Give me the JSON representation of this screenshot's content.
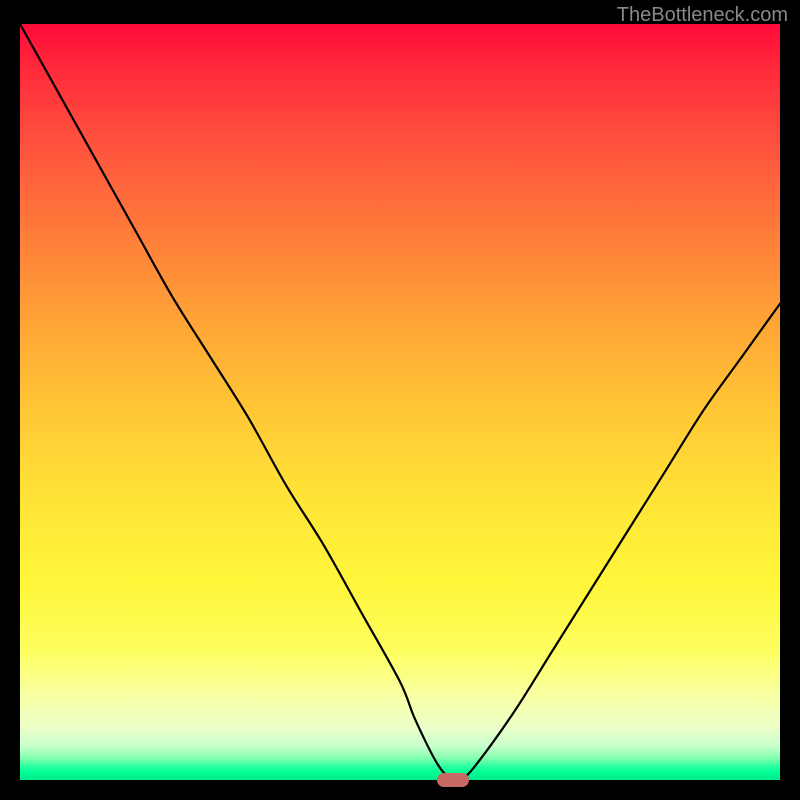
{
  "watermark": "TheBottleneck.com",
  "chart_data": {
    "type": "line",
    "title": "",
    "xlabel": "",
    "ylabel": "",
    "xlim": [
      0,
      100
    ],
    "ylim": [
      0,
      100
    ],
    "grid": false,
    "legend": false,
    "background_gradient": {
      "direction": "vertical",
      "stops": [
        {
          "pos": 0,
          "color": "#ff0a3a"
        },
        {
          "pos": 50,
          "color": "#ffc935"
        },
        {
          "pos": 80,
          "color": "#fff63a"
        },
        {
          "pos": 100,
          "color": "#00e98c"
        }
      ]
    },
    "series": [
      {
        "name": "bottleneck-curve",
        "color": "#000000",
        "x": [
          0,
          5,
          10,
          15,
          20,
          25,
          30,
          35,
          40,
          45,
          50,
          52,
          55,
          57,
          58,
          60,
          65,
          70,
          75,
          80,
          85,
          90,
          95,
          100
        ],
        "y": [
          100,
          91,
          82,
          73,
          64,
          56,
          48,
          39,
          31,
          22,
          13,
          8,
          2,
          0,
          0,
          2,
          9,
          17,
          25,
          33,
          41,
          49,
          56,
          63
        ]
      }
    ],
    "annotations": [
      {
        "name": "optimal-marker",
        "shape": "rounded-rect",
        "color": "#c86a63",
        "x": 57,
        "y": 0,
        "width_pct": 4.2,
        "height_pct": 1.8
      }
    ]
  }
}
